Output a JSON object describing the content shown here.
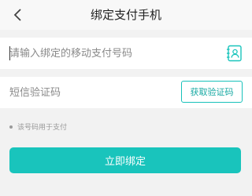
{
  "header": {
    "title": "绑定支付手机"
  },
  "phone_field": {
    "placeholder": "请输入绑定的移动支付号码",
    "value": ""
  },
  "sms_field": {
    "placeholder": "短信验证码",
    "value": ""
  },
  "get_code_button": {
    "label": "获取验证码"
  },
  "hint": {
    "text": "该号码用于支付"
  },
  "submit_button": {
    "label": "立即绑定"
  },
  "icons": {
    "back": "chevron-left-icon",
    "contacts": "contact-book-icon"
  },
  "colors": {
    "accent": "#19c4bc",
    "background": "#f2f2f2"
  }
}
